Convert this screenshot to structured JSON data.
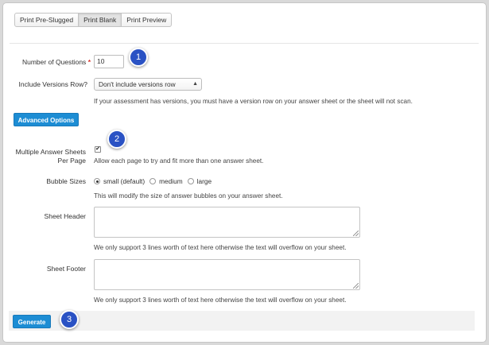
{
  "tabs": [
    "Print Pre-Slugged",
    "Print Blank",
    "Print Preview"
  ],
  "active_tab": "Print Blank",
  "questions": {
    "label": "Number of Questions",
    "required_mark": "*",
    "value": "10"
  },
  "versions": {
    "label": "Include Versions Row?",
    "selected": "Don't include versions row",
    "help": "If your assessment has versions, you must have a version row on your answer sheet or the sheet will not scan."
  },
  "advanced_button": "Advanced Options",
  "multiple_sheets": {
    "label_line1": "Multiple Answer Sheets",
    "label_line2": "Per Page",
    "checked": true,
    "check_glyph": "✔",
    "help": "Allow each page to try and fit more than one answer sheet."
  },
  "bubble_sizes": {
    "label": "Bubble Sizes",
    "options": [
      "small (default)",
      "medium",
      "large"
    ],
    "selected": "small (default)",
    "help": "This will modify the size of answer bubbles on your answer sheet."
  },
  "sheet_header": {
    "label": "Sheet Header",
    "value": "",
    "help": "We only support 3 lines worth of text here otherwise the text will overflow on your sheet."
  },
  "sheet_footer": {
    "label": "Sheet Footer",
    "value": "",
    "help": "We only support 3 lines worth of text here otherwise the text will overflow on your sheet."
  },
  "generate_button": "Generate",
  "callouts": [
    "1",
    "2",
    "3"
  ],
  "colors": {
    "primary_button": "#1d8dd4",
    "callout": "#2a52c4",
    "required": "#d9342b"
  }
}
